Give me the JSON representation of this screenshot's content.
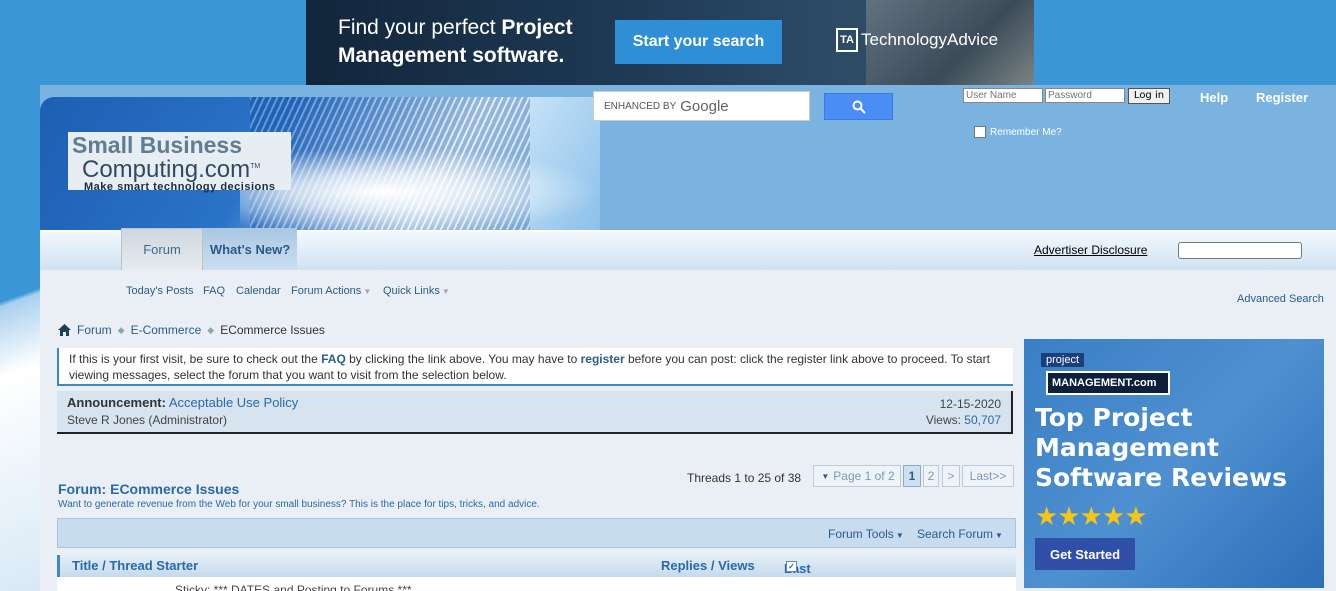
{
  "top_ad": {
    "line1_regular": "Find your perfect ",
    "line1_bold": "Project",
    "line2": "Management software.",
    "cta": "Start your search",
    "brand_mark": "TA",
    "brand": "TechnologyAdvice"
  },
  "logo": {
    "line1": "Small Business",
    "line2": "Computing.com",
    "tm": "TM",
    "tagline": "Make smart technology decisions"
  },
  "google_search": {
    "enhanced_by": "ENHANCED BY",
    "google": "Google"
  },
  "login": {
    "username_placeholder": "User Name",
    "password_placeholder": "Password",
    "login_button": "Log in",
    "remember_me": "Remember Me?"
  },
  "top_links": {
    "help": "Help",
    "register": "Register"
  },
  "nav": {
    "tabs": [
      {
        "label": "Forum"
      },
      {
        "label": "What's New?"
      }
    ],
    "advertiser_disclosure": "Advertiser Disclosure"
  },
  "sub_nav": {
    "items": [
      {
        "label": "Today's Posts"
      },
      {
        "label": "FAQ"
      },
      {
        "label": "Calendar"
      },
      {
        "label": "Forum Actions"
      },
      {
        "label": "Quick Links"
      }
    ],
    "advanced_search": "Advanced Search"
  },
  "breadcrumb": {
    "items": [
      "Forum",
      "E-Commerce"
    ],
    "current": "ECommerce Issues"
  },
  "notice": {
    "p1": "If this is your first visit, be sure to check out the ",
    "faq": "FAQ",
    "p2": " by clicking the link above. You may have to ",
    "register": "register",
    "p3": " before you can post: click the register link above to proceed. To start viewing messages, select the forum that you want to visit from the selection below."
  },
  "announcement": {
    "label": "Announcement:",
    "title": "Acceptable Use Policy",
    "author": "Steve R Jones (Administrator)",
    "date": "12-15-2020",
    "views_label": "Views:",
    "views": "50,707"
  },
  "threads": {
    "count_text": "Threads 1 to 25 of 38",
    "pager_dropdown": "Page 1 of 2",
    "pages": [
      "1",
      "2"
    ],
    "next": ">",
    "last": "Last>>"
  },
  "forum": {
    "title": "Forum: ECommerce Issues",
    "description": "Want to generate revenue from the Web for your small business? This is the place for tips, tricks, and advice.",
    "tools": "Forum Tools",
    "search": "Search Forum"
  },
  "table": {
    "col_title": "Title / Thread Starter",
    "col_replies": "Replies / Views",
    "col_lastpost": "Last Post By",
    "first_row": "Sticky: *** DATES and Posting to Forums ***"
  },
  "right_ad": {
    "tag": "project",
    "brand": "MANAGEMENT.com",
    "headline": "Top Project Management Software Reviews",
    "stars": "★★★★★",
    "cta": "Get Started"
  }
}
